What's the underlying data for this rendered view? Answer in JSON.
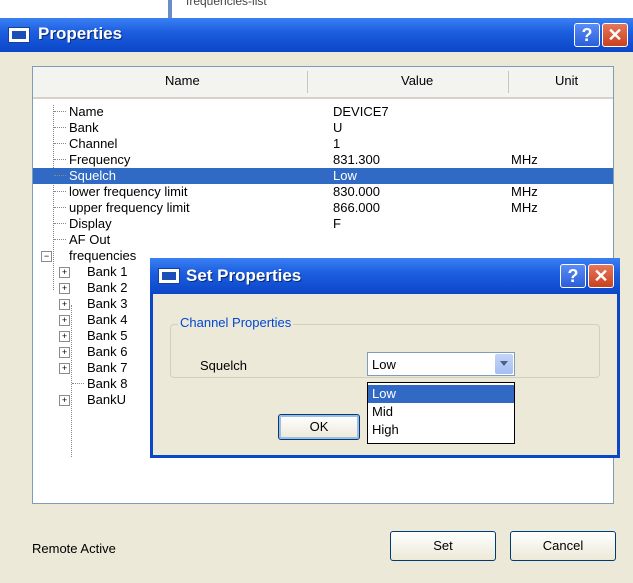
{
  "background_window": {
    "cut_text": "frequencies-list"
  },
  "window": {
    "title": "Properties",
    "help_label": "?",
    "close_label": "✕"
  },
  "columns": {
    "name": "Name",
    "value": "Value",
    "unit": "Unit"
  },
  "rows": [
    {
      "name": "Name",
      "value": "DEVICE7",
      "unit": ""
    },
    {
      "name": "Bank",
      "value": "U",
      "unit": ""
    },
    {
      "name": "Channel",
      "value": "1",
      "unit": ""
    },
    {
      "name": "Frequency",
      "value": "831.300",
      "unit": "MHz"
    },
    {
      "name": "Squelch",
      "value": "Low",
      "unit": ""
    },
    {
      "name": "lower frequency limit",
      "value": "830.000",
      "unit": "MHz"
    },
    {
      "name": "upper frequency limit",
      "value": "866.000",
      "unit": "MHz"
    },
    {
      "name": "Display",
      "value": "F",
      "unit": ""
    },
    {
      "name": "AF Out",
      "value": "",
      "unit": ""
    },
    {
      "name": "frequencies",
      "value": "",
      "unit": ""
    }
  ],
  "banks": [
    "Bank 1",
    "Bank 2",
    "Bank 3",
    "Bank 4",
    "Bank 5",
    "Bank 6",
    "Bank 7",
    "Bank 8",
    "BankU"
  ],
  "status": "Remote Active",
  "buttons": {
    "set": "Set",
    "cancel": "Cancel"
  },
  "dialog": {
    "title": "Set Properties",
    "group_label": "Channel Properties",
    "field_label": "Squelch",
    "selected": "Low",
    "options": [
      "Low",
      "Mid",
      "High"
    ],
    "ok": "OK"
  },
  "colors": {
    "titlebar": "#0a46c8",
    "selection": "#316ac5",
    "dialog_bg": "#ece9d8"
  }
}
